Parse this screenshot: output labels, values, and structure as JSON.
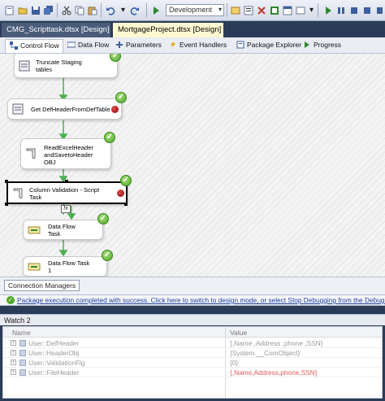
{
  "toolbar": {
    "configuration": "Development",
    "buttons": [
      "new-project-icon",
      "open-icon",
      "save-icon",
      "save-all-icon",
      "cut-icon",
      "copy-icon",
      "paste-icon",
      "undo-icon",
      "redo-icon",
      "start-icon",
      "solution-explorer-icon",
      "properties-icon",
      "toolbox-icon",
      "misc-icon",
      "start-debug-icon",
      "pause-icon",
      "stop-icon",
      "step-icon",
      "breakpoint-icon"
    ]
  },
  "document_tabs": [
    {
      "label": "CMG_Scripttask.dtsx [Design]",
      "active": false
    },
    {
      "label": "MortgageProject.dtsx [Design]",
      "active": true
    }
  ],
  "designer_tabs": [
    {
      "label": "Control Flow",
      "icon": "control-flow-icon",
      "selected": true
    },
    {
      "label": "Data Flow",
      "icon": "data-flow-icon",
      "selected": false
    },
    {
      "label": "Parameters",
      "icon": "parameters-icon",
      "selected": false
    },
    {
      "label": "Event Handlers",
      "icon": "event-handlers-icon",
      "selected": false
    },
    {
      "label": "Package Explorer",
      "icon": "package-explorer-icon",
      "selected": false
    },
    {
      "label": "Progress",
      "icon": "progress-icon",
      "selected": false
    }
  ],
  "tasks": [
    {
      "label": "Truncate Staging\ntables",
      "icon": "sql-task-icon",
      "status": "success",
      "breakpoint": false,
      "selected": false
    },
    {
      "label": "Get DefHeaderFromDefTable",
      "icon": "sql-task-icon",
      "status": "success",
      "breakpoint": true,
      "selected": false
    },
    {
      "label": "ReadExcelHeader\nandSavetoHeader\nOBJ",
      "icon": "script-task-icon",
      "status": "success",
      "breakpoint": false,
      "selected": false
    },
    {
      "label": "Column Validation - Script\nTask",
      "icon": "script-task-icon",
      "status": "success",
      "breakpoint": true,
      "selected": true
    },
    {
      "label": "Data Flow\nTask",
      "icon": "data-flow-task-icon",
      "status": "success",
      "breakpoint": false,
      "selected": false
    },
    {
      "label": "Data Flow Task\n1",
      "icon": "data-flow-task-icon",
      "status": "success",
      "breakpoint": false,
      "selected": false
    }
  ],
  "precedence_expression_label": "fx",
  "connection_managers": {
    "label": "Connection Managers"
  },
  "status_message": "Package execution completed with success. Click here to switch to design mode, or select Stop Debugging from the Debug menu.",
  "watch": {
    "title": "Watch 2",
    "columns": [
      "Name",
      "Value"
    ],
    "rows": [
      {
        "name": "User::DefHeader",
        "value": "{,Name ,Address ,phone ,SSN}",
        "changed": false
      },
      {
        "name": "User::HeaderObj",
        "value": "{System.__ComObject}",
        "changed": false
      },
      {
        "name": "User::ValidationFlg",
        "value": "{0}",
        "changed": false
      },
      {
        "name": "User::FileHeader",
        "value": "{,Name,Address,phone,SSN}",
        "changed": true
      }
    ]
  },
  "colors": {
    "success": "#4ea62a",
    "breakpoint": "#b00000",
    "connector": "#4caf50",
    "active_doc_tab": "#fff8d1",
    "changed_value": "#e05a5a"
  }
}
